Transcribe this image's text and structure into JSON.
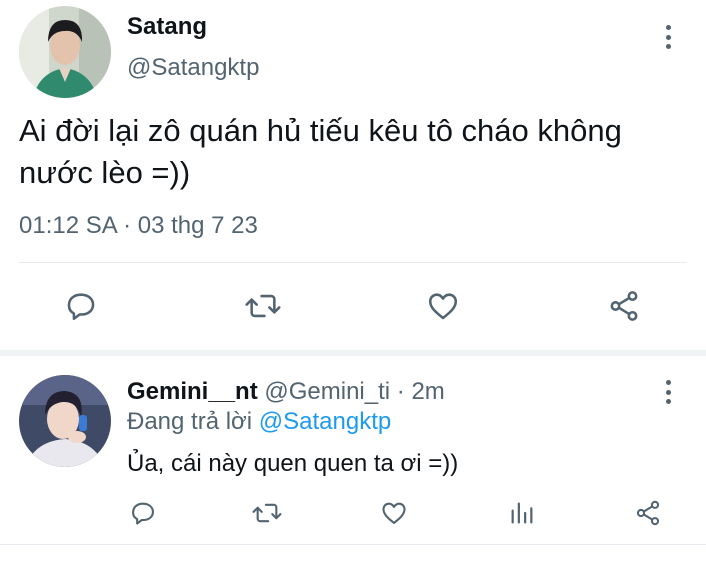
{
  "tweet": {
    "author_name": "Satang",
    "author_handle": "@Satangktp",
    "text": "Ai đời lại zô quán hủ tiếu kêu tô cháo không nước lèo =))",
    "timestamp": "01:12 SA · 03 thg 7 23"
  },
  "reply": {
    "author_name": "Gemini__nt",
    "author_handle": "@Gemini_ti",
    "separator": " · ",
    "time": "2m",
    "replying_prefix": "Đang trả lời ",
    "replying_to": "@Satangktp",
    "text": "Ủa, cái này quen quen ta ơi =))"
  },
  "icons": {
    "actions": [
      "reply-icon",
      "retweet-icon",
      "like-icon",
      "share-icon"
    ],
    "reply_actions": [
      "reply-icon",
      "retweet-icon",
      "like-icon",
      "views-icon",
      "share-icon"
    ],
    "more": "more-options-icon"
  },
  "colors": {
    "primary_text": "#0f1419",
    "secondary_text": "#536471",
    "mention": "#1d9bf0",
    "divider": "#e6ecf0"
  }
}
